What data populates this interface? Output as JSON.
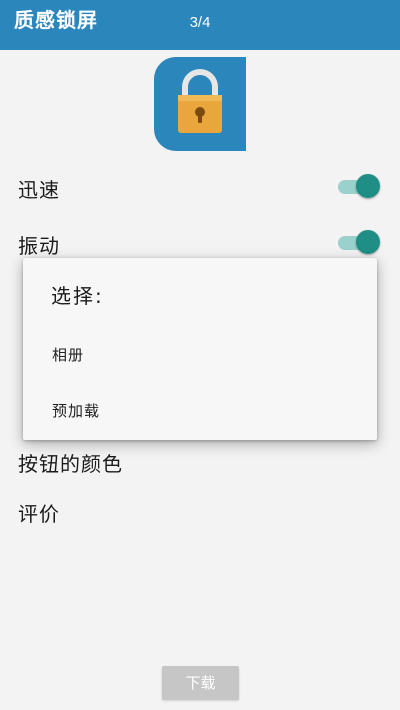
{
  "header": {
    "app_title": "质感锁屏",
    "page_indicator": "3/4",
    "color": "#2a86bb"
  },
  "app_icon": {
    "name": "padlock-icon",
    "background": "#2a86bb",
    "lock_color": "#e9a63c"
  },
  "settings": [
    {
      "label": "迅速",
      "toggle": true
    },
    {
      "label": "振动",
      "toggle": true
    },
    {
      "label": "按钮的颜色"
    },
    {
      "label": "评价"
    }
  ],
  "toggle_colors": {
    "thumb": "#1f8f86",
    "track": "#9bd1cc"
  },
  "dialog": {
    "title": "选择:",
    "options": [
      "相册",
      "预加载"
    ]
  },
  "download_button": {
    "label": "下载"
  }
}
